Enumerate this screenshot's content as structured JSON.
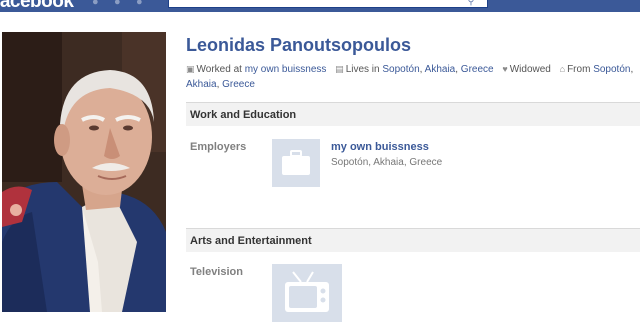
{
  "header": {
    "logo_text": "facebook",
    "search_placeholder": ""
  },
  "profile": {
    "name": "Leonidas Panoutsopoulos",
    "worked_at_prefix": "Worked at",
    "worked_at_link": "my own buissness",
    "lives_prefix": "Lives in",
    "lives_city": "Sopotón",
    "lives_region": "Akhaia",
    "lives_country": "Greece",
    "status": "Widowed",
    "from_prefix": "From",
    "from_city": "Sopotón",
    "from_region": "Akhaia",
    "from_country": "Greece"
  },
  "sections": {
    "work": {
      "title": "Work and Education",
      "employers_label": "Employers",
      "employer_name": "my own buissness",
      "employer_location": "Sopotón, Akhaia, Greece"
    },
    "arts": {
      "title": "Arts and Entertainment",
      "television_label": "Television"
    }
  },
  "colors": {
    "brand": "#3b5998",
    "tile": "#d8dfea",
    "section_bg": "#f2f2f2"
  },
  "icons": [
    "briefcase-icon",
    "building-icon",
    "heart-icon",
    "home-icon",
    "television-icon"
  ]
}
